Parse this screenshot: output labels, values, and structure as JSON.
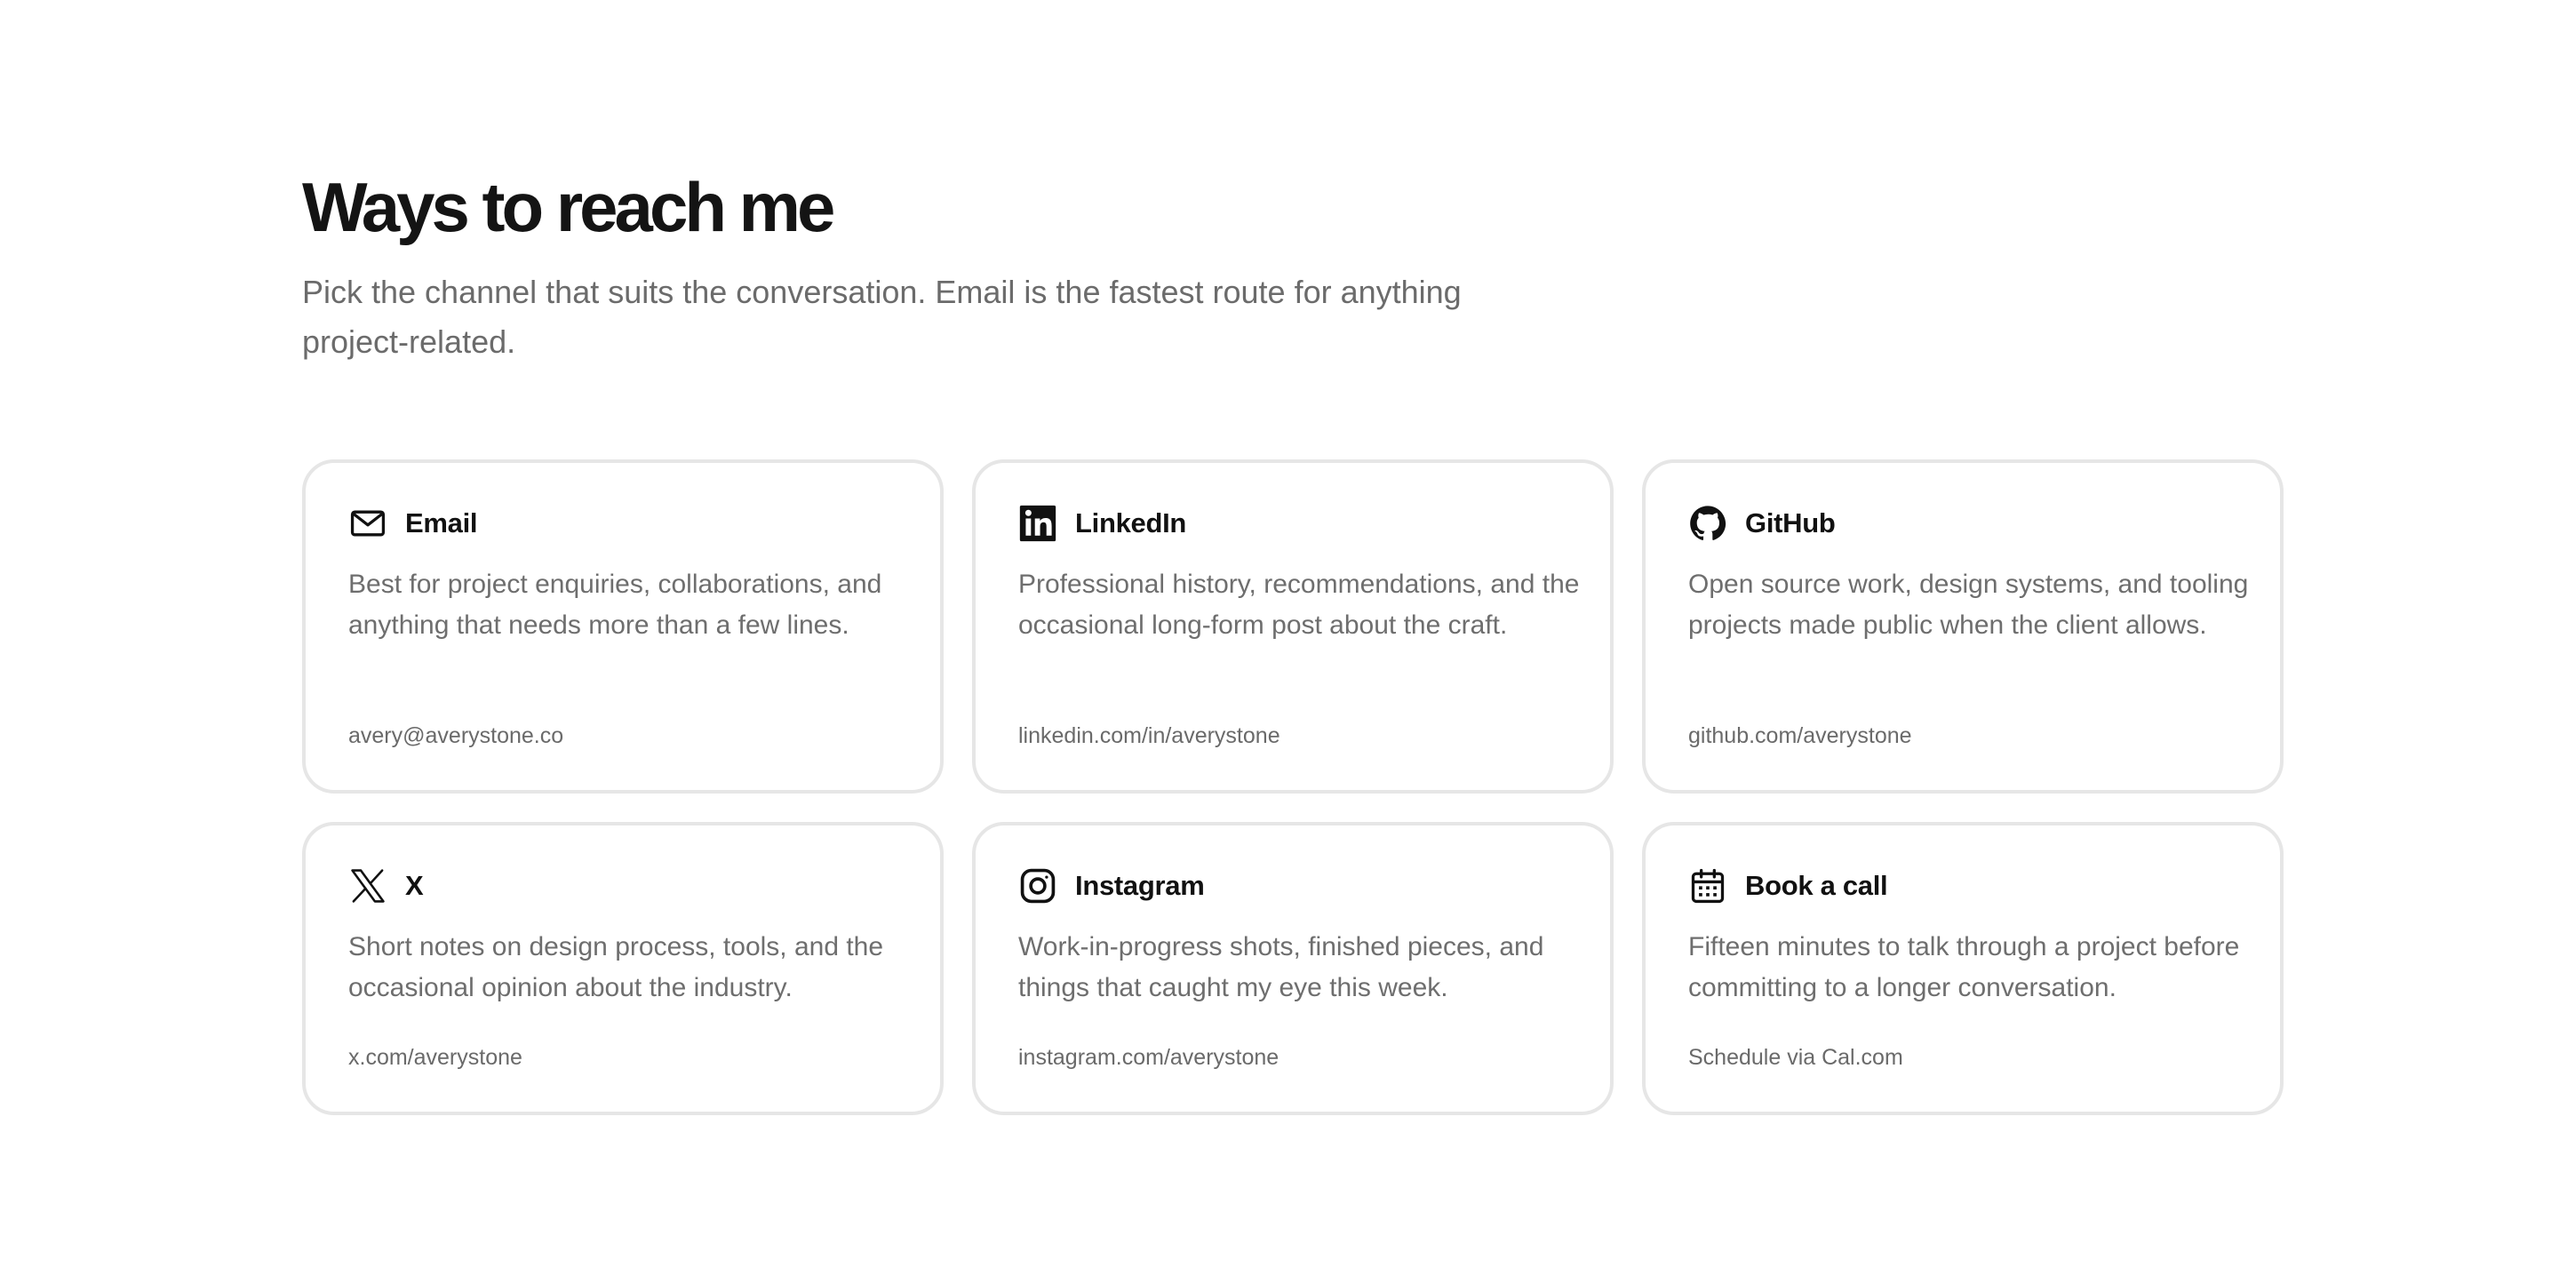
{
  "page": {
    "title": "Ways to reach me",
    "subtitle": "Pick the channel that suits the conversation. Email is the fastest route for anything project-related."
  },
  "cards": [
    {
      "icon": "mail-icon",
      "title": "Email",
      "description": "Best for project enquiries, collaborations, and anything that needs more than a few lines.",
      "link": "avery@averystone.co"
    },
    {
      "icon": "linkedin-icon",
      "title": "LinkedIn",
      "description": "Professional history, recommendations, and the occasional long-form post about the craft.",
      "link": "linkedin.com/in/averystone"
    },
    {
      "icon": "github-icon",
      "title": "GitHub",
      "description": "Open source work, design systems, and tooling projects made public when the client allows.",
      "link": "github.com/averystone"
    },
    {
      "icon": "x-icon",
      "title": "X",
      "description": "Short notes on design process, tools, and the occasional opinion about the industry.",
      "link": "x.com/averystone"
    },
    {
      "icon": "instagram-icon",
      "title": "Instagram",
      "description": "Work-in-progress shots, finished pieces, and things that caught my eye this week.",
      "link": "instagram.com/averystone"
    },
    {
      "icon": "calendar-icon",
      "title": "Book a call",
      "description": "Fifteen minutes to talk through a project before committing to a longer conversation.",
      "link": "Schedule via Cal.com"
    }
  ],
  "colors": {
    "heading": "#141414",
    "muted_text": "#6e6e6e",
    "card_border": "#e6e6e6",
    "background": "#ffffff"
  }
}
